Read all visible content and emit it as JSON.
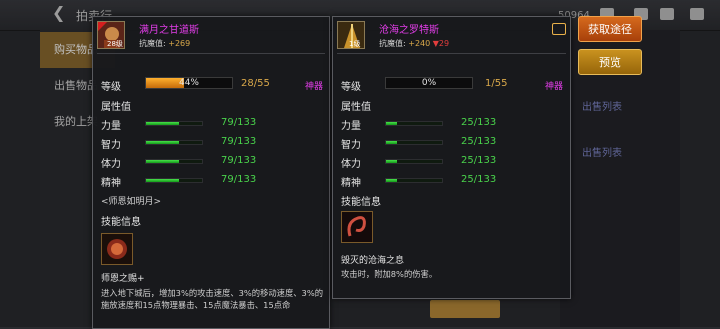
{
  "background": {
    "title": "拍卖行",
    "left_nav": [
      "购买物品",
      "出售物品",
      "我的上架"
    ],
    "list_text": "出售列表",
    "corner_number": "50964"
  },
  "left_item": {
    "name": "满月之甘道斯",
    "level_badge": "28级",
    "attack_label": "抗魔值:",
    "attack_value": "+269",
    "level_label": "等级",
    "level_percent": "44%",
    "level_fraction": 0.44,
    "level_value": "28/55",
    "level_tag": "神器",
    "stats_title": "属性值",
    "stats": [
      {
        "label": "力量",
        "value": "79/133",
        "fraction": 0.594
      },
      {
        "label": "智力",
        "value": "79/133",
        "fraction": 0.594
      },
      {
        "label": "体力",
        "value": "79/133",
        "fraction": 0.594
      },
      {
        "label": "精神",
        "value": "79/133",
        "fraction": 0.594
      }
    ],
    "quote": "<师恩如明月>",
    "skill_title": "技能信息",
    "skill_name": "师恩之赐+",
    "skill_desc": "进入地下城后，增加3%的攻击速度、3%的移动速度、3%的施放速度和15点物理暴击、15点魔法暴击、15点命"
  },
  "right_item": {
    "name": "沧海之罗特斯",
    "level_badge": "1级",
    "attack_label": "抗魔值:",
    "attack_value": "+240",
    "attack_diff": "▼29",
    "level_label": "等级",
    "level_percent": "0%",
    "level_fraction": 0.0,
    "level_value": "1/55",
    "level_tag": "神器",
    "stats_title": "属性值",
    "stats": [
      {
        "label": "力量",
        "value": "25/133",
        "fraction": 0.188
      },
      {
        "label": "智力",
        "value": "25/133",
        "fraction": 0.188
      },
      {
        "label": "体力",
        "value": "25/133",
        "fraction": 0.188
      },
      {
        "label": "精神",
        "value": "25/133",
        "fraction": 0.188
      }
    ],
    "skill_title": "技能信息",
    "skill_name": "毁灭的沧海之息",
    "skill_desc": "攻击时，附加8%的伤害。"
  },
  "buttons": {
    "obtain": "获取途径",
    "preview": "预览"
  },
  "colors": {
    "item_name": "#e23de8",
    "stat_value": "#49d24b",
    "level_value": "#d9a84a",
    "accent_orange": "#d66a1d"
  }
}
